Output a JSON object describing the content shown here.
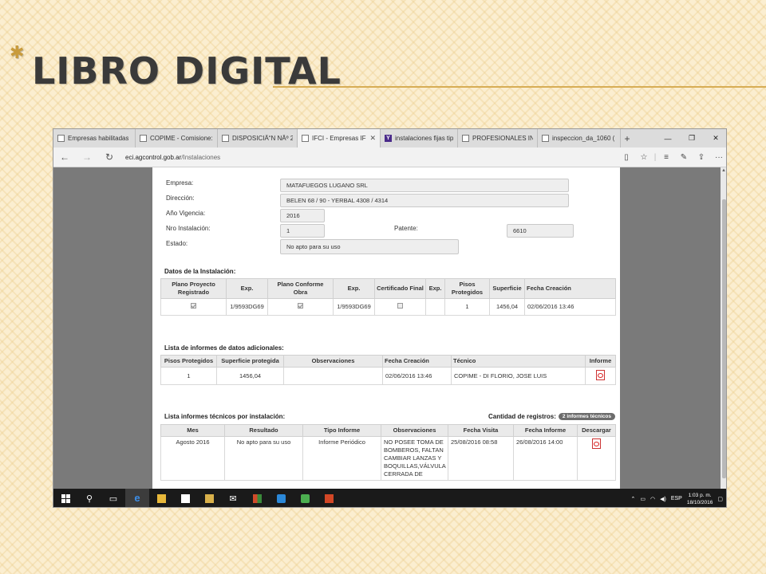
{
  "slide": {
    "title": "LIBRO DIGITAL",
    "bullet_glyph": "✱"
  },
  "browser": {
    "tabs": [
      {
        "label": "Empresas habilitadas",
        "icon": "page-icon",
        "active": false
      },
      {
        "label": "COPIME - Comisione:",
        "icon": "shield-icon",
        "active": false
      },
      {
        "label": "DISPOSICIÃ“N NÂº 2",
        "icon": "page-icon",
        "active": false
      },
      {
        "label": "IFCI - Empresas IF",
        "icon": "page-icon",
        "active": true
      },
      {
        "label": "instalaciones fijas tipo",
        "icon": "yahoo-icon",
        "active": false
      },
      {
        "label": "PROFESIONALES IND",
        "icon": "page-icon",
        "active": false
      },
      {
        "label": "inspeccion_da_1060 (",
        "icon": "page-icon",
        "active": false
      }
    ],
    "address": {
      "domain": "eci.agcontrol.gob.ar",
      "path": "/Instalaciones"
    }
  },
  "form": {
    "empresa_label": "Empresa:",
    "empresa_value": "MATAFUEGOS LUGANO  SRL",
    "direccion_label": "Dirección:",
    "direccion_value": "BELEN 68 / 90 - YERBAL 4308 / 4314",
    "vigencia_label": "Año Vigencia:",
    "vigencia_value": "2016",
    "nro_label": "Nro Instalación:",
    "nro_value": "1",
    "patente_label": "Patente:",
    "patente_value": "6610",
    "estado_label": "Estado:",
    "estado_value": "No apto para su uso"
  },
  "datos": {
    "title": "Datos de la Instalación:",
    "headers": [
      "Plano Proyecto Registrado",
      "Exp.",
      "Plano Conforme Obra",
      "Exp.",
      "Certificado Final",
      "Exp.",
      "Pisos Protegidos",
      "Superficie",
      "Fecha Creación"
    ],
    "row": {
      "plano_proyecto_checked": true,
      "exp1": "1/9593DG69",
      "plano_conforme_checked": true,
      "exp2": "1/9593DG69",
      "certificado_checked": false,
      "exp3": "",
      "pisos": "1",
      "superficie": "1456,04",
      "fecha": "02/06/2016 13:46"
    }
  },
  "adicionales": {
    "title": "Lista de informes de datos adicionales:",
    "headers": [
      "Pisos Protegidos",
      "Superficie protegida",
      "Observaciones",
      "Fecha Creación",
      "Técnico",
      "Informe"
    ],
    "row": {
      "pisos": "1",
      "superficie": "1456,04",
      "observaciones": "",
      "fecha": "02/06/2016 13:46",
      "tecnico": "COPIME - DI FLORIO, JOSE LUIS"
    }
  },
  "tecnicos": {
    "title": "Lista informes técnicos por instalación:",
    "count_label": "Cantidad de registros:",
    "count_badge": "2 informes técnicos",
    "headers": [
      "Mes",
      "Resultado",
      "Tipo Informe",
      "Observaciones",
      "Fecha Visita",
      "Fecha Informe",
      "Descargar"
    ],
    "row": {
      "mes": "Agosto 2016",
      "resultado": "No apto para su uso",
      "tipo": "Informe Periódico",
      "observaciones": "NO POSEE TOMA DE BOMBEROS, FALTAN CAMBIAR LANZAS Y BOQUILLAS,VÁLVULA CERRADA DE",
      "fecha_visita": "25/08/2016 08:58",
      "fecha_informe": "26/08/2016 14:00"
    }
  },
  "taskbar": {
    "language": "ESP",
    "time": "1:03 p. m.",
    "date": "18/10/2016"
  }
}
